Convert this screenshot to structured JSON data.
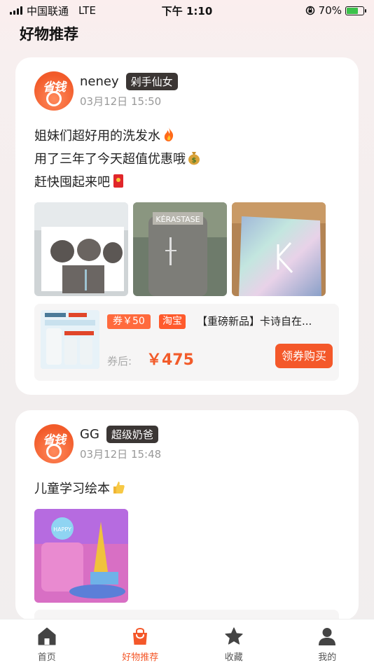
{
  "status_bar": {
    "carrier": "中国联通",
    "network": "LTE",
    "time": "下午 1:10",
    "battery_text": "70%",
    "battery_level": 0.7
  },
  "header": {
    "title": "好物推荐"
  },
  "posts": [
    {
      "avatar_text": "省钱",
      "user_name": "neney",
      "badge": "剁手仙女",
      "time": "03月12日 15:50",
      "lines": [
        "姐妹们超好用的洗发水",
        "用了三年了今天超值优惠哦",
        "赶快囤起来吧"
      ],
      "product": {
        "coupon": "券￥50",
        "platform": "淘宝",
        "title": "【重磅新品】卡诗自在...",
        "after_label": "券后:",
        "price": "￥475",
        "buy_label": "领券购买"
      }
    },
    {
      "avatar_text": "省钱",
      "user_name": "GG",
      "badge": "超级奶爸",
      "time": "03月12日 15:48",
      "lines": [
        "儿童学习绘本"
      ]
    }
  ],
  "tabs": [
    {
      "label": "首页",
      "icon": "home-icon",
      "active": false
    },
    {
      "label": "好物推荐",
      "icon": "bag-icon",
      "active": true
    },
    {
      "label": "收藏",
      "icon": "star-icon",
      "active": false
    },
    {
      "label": "我的",
      "icon": "user-icon",
      "active": false
    }
  ],
  "colors": {
    "accent": "#f4582a",
    "badge_bg": "#3b3634"
  }
}
